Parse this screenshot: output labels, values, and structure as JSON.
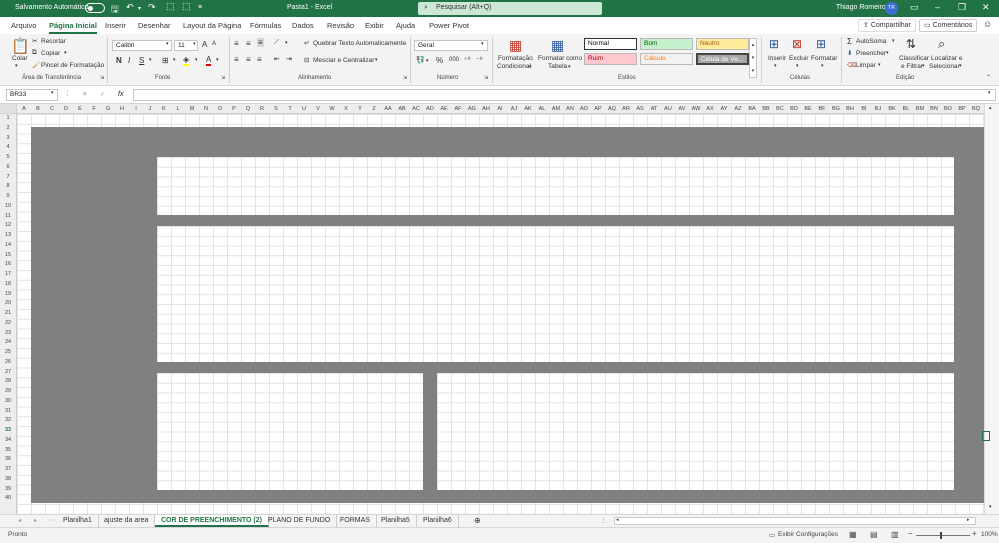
{
  "titlebar": {
    "autosave_label": "Salvamento Automático",
    "window_title": "Pasta1  -  Excel",
    "search_placeholder": "Pesquisar (Alt+Q)",
    "user_name": "Thiago Romeiro",
    "user_initials": "TR"
  },
  "menu": {
    "items": [
      "Arquivo",
      "Página Inicial",
      "Inserir",
      "Desenhar",
      "Layout da Página",
      "Fórmulas",
      "Dados",
      "Revisão",
      "Exibir",
      "Ajuda",
      "Power Pivot"
    ],
    "active_index": 1,
    "share_label": "Compartilhar",
    "comments_label": "Comentários"
  },
  "ribbon": {
    "clipboard": {
      "paste_label": "Colar",
      "cut_label": "Recortar",
      "copy_label": "Copiar",
      "painter_label": "Pincel de Formatação",
      "group_label": "Área de Transferência"
    },
    "font": {
      "font_name": "Calibri",
      "font_size": "11",
      "bold_label": "N",
      "italic_label": "I",
      "underline_label": "S",
      "group_label": "Fonte",
      "grow_label": "A",
      "shrink_label": "A"
    },
    "alignment": {
      "wrap_label": "Quebrar Texto Automaticamente",
      "merge_label": "Mesclar e Centralizar",
      "group_label": "Alinhamento"
    },
    "number": {
      "format_value": "Geral",
      "group_label": "Número",
      "percent_label": "%",
      "thousands_label": "000"
    },
    "styles": {
      "conditional_label_1": "Formatação",
      "conditional_label_2": "Condicional",
      "table_label_1": "Formatar como",
      "table_label_2": "Tabela",
      "cells": [
        {
          "label": "Normal",
          "bg": "#ffffff",
          "fg": "#000000"
        },
        {
          "label": "Bom",
          "bg": "#c6efce",
          "fg": "#006100"
        },
        {
          "label": "Neutro",
          "bg": "#ffeb9c",
          "fg": "#9c5700"
        },
        {
          "label": "Ruim",
          "bg": "#ffc7ce",
          "fg": "#9c0006"
        },
        {
          "label": "Cálculo",
          "bg": "#f2f2f2",
          "fg": "#fa7d00"
        },
        {
          "label": "Célula de Ve...",
          "bg": "#a5a5a5",
          "fg": "#ffffff"
        }
      ],
      "group_label": "Estilos"
    },
    "cells": {
      "insert_label": "Inserir",
      "delete_label": "Excluir",
      "format_label": "Formatar",
      "group_label": "Células"
    },
    "editing": {
      "autosum_label": "AutoSoma",
      "fill_label": "Preencher",
      "clear_label": "Limpar",
      "sort_label_1": "Classificar",
      "sort_label_2": "e Filtrar",
      "find_label_1": "Localizar e",
      "find_label_2": "Selecionar",
      "group_label": "Edição"
    }
  },
  "formula_bar": {
    "name_box": "BR33",
    "fx_label": "fx",
    "formula": ""
  },
  "grid": {
    "columns": [
      "A",
      "B",
      "C",
      "D",
      "E",
      "F",
      "G",
      "H",
      "I",
      "J",
      "K",
      "L",
      "M",
      "N",
      "O",
      "P",
      "Q",
      "R",
      "S",
      "T",
      "U",
      "V",
      "W",
      "X",
      "Y",
      "Z",
      "AA",
      "AB",
      "AC",
      "AD",
      "AE",
      "AF",
      "AG",
      "AH",
      "AI",
      "AJ",
      "AK",
      "AL",
      "AM",
      "AN",
      "AO",
      "AP",
      "AQ",
      "AR",
      "AS",
      "AT",
      "AU",
      "AV",
      "AW",
      "AX",
      "AY",
      "AZ",
      "BA",
      "BB",
      "BC",
      "BD",
      "BE",
      "BF",
      "BG",
      "BH",
      "BI",
      "BJ",
      "BK",
      "BL",
      "BM",
      "BN",
      "BO",
      "BP",
      "BQ"
    ],
    "row_count": 40,
    "fill_color": "#808080"
  },
  "sheets": {
    "tabs": [
      "Planilha1",
      "ajuste da area",
      "COR DE PREENCHIMENTO (2)",
      "PLANO DE FUNDO",
      "FORMAS",
      "Planilha5",
      "Planilha6"
    ],
    "active_index": 2
  },
  "status": {
    "ready": "Pronto",
    "display_settings": "Exibir Configurações",
    "zoom": "100%"
  },
  "colors": {
    "accent": "#217346"
  }
}
